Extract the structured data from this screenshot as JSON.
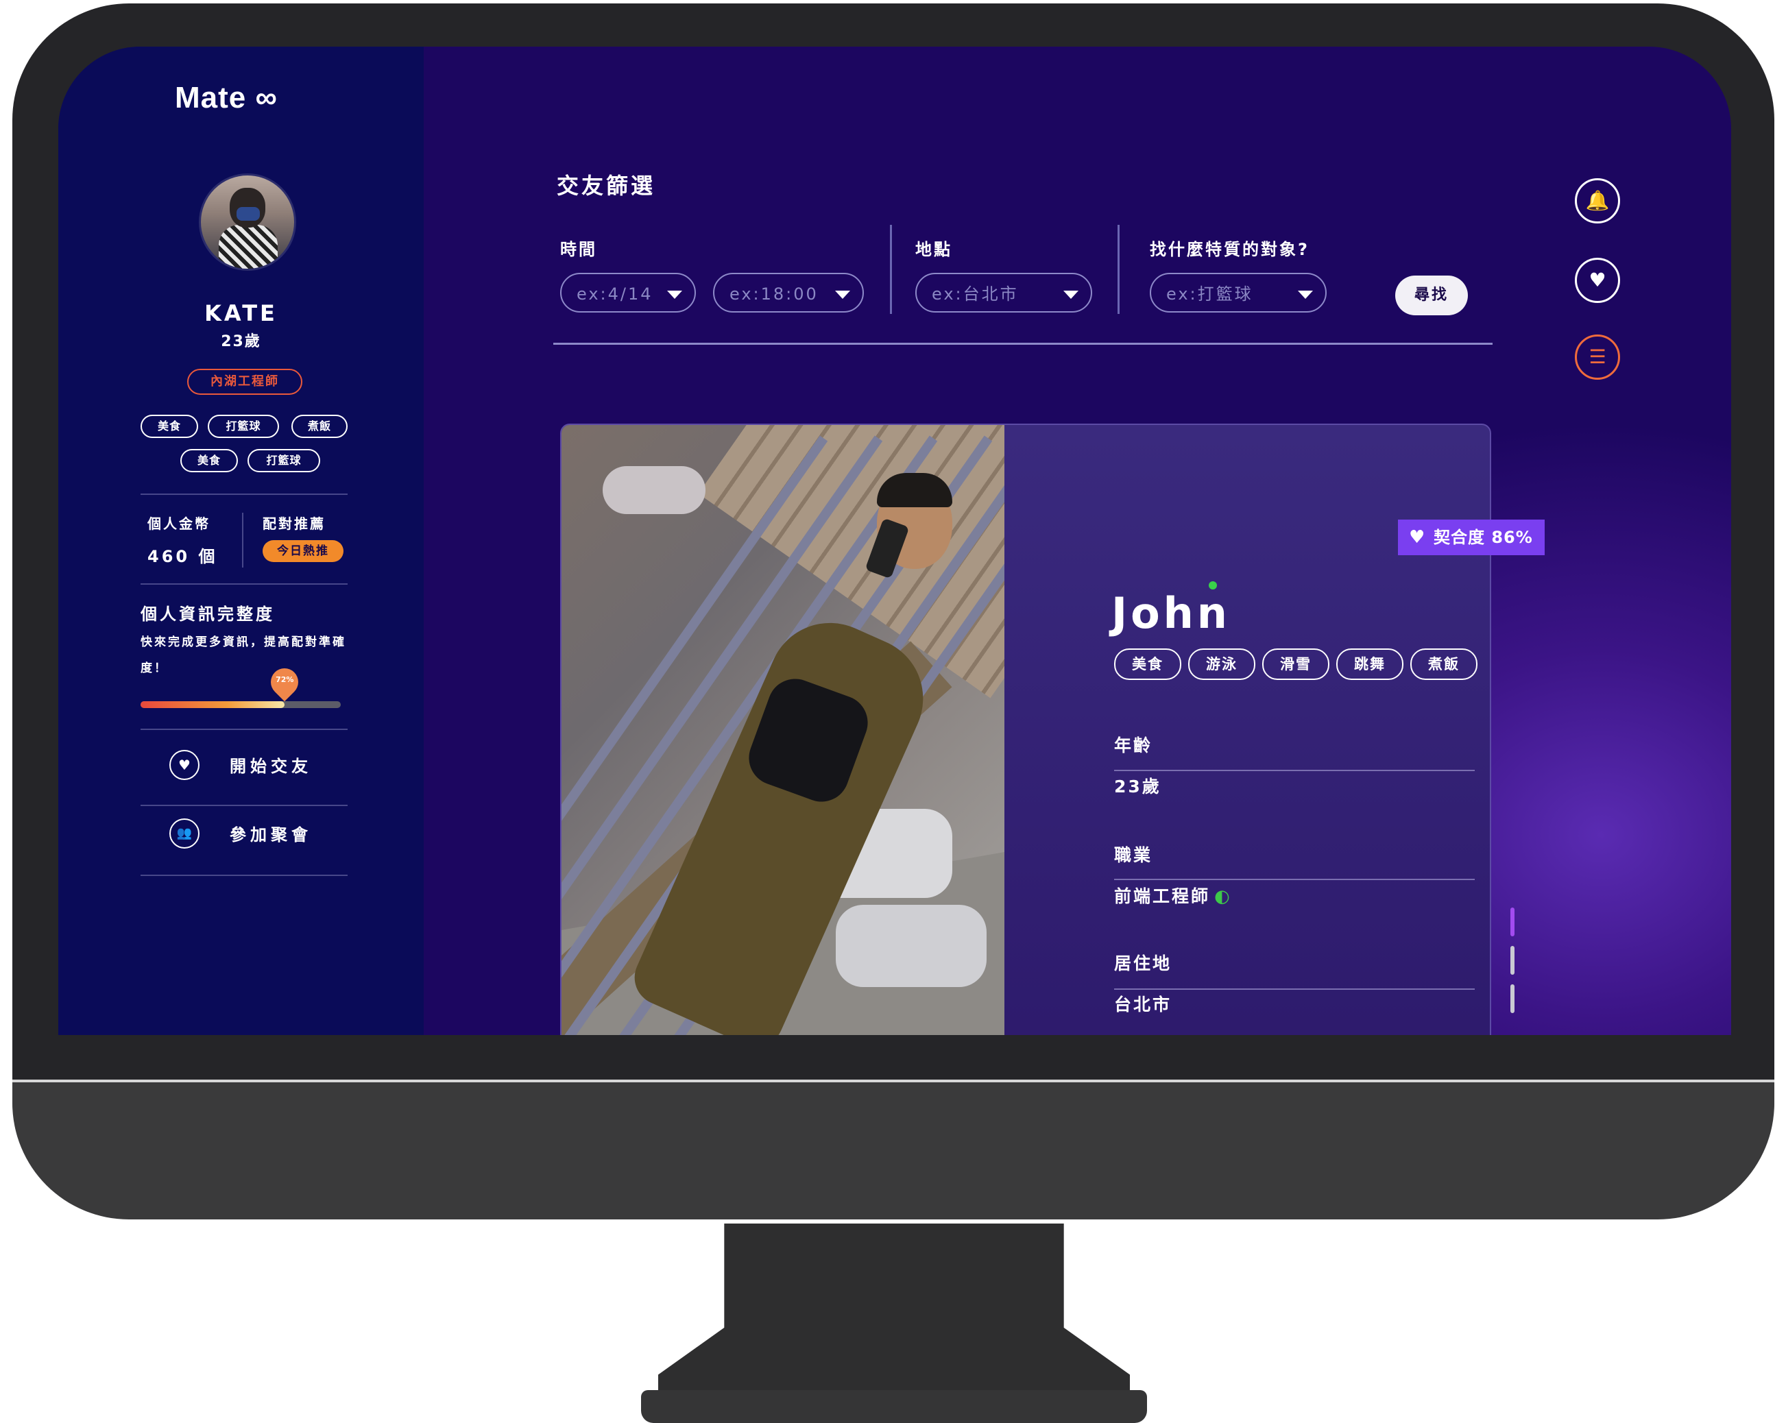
{
  "app": {
    "logo": "Mate ∞"
  },
  "sidebar": {
    "user": {
      "name": "KATE",
      "age": "23歲",
      "job": "內湖工程師"
    },
    "tags": [
      "美食",
      "打籃球",
      "煮飯",
      "美食",
      "打籃球"
    ],
    "stats": {
      "coins_label": "個人金幣",
      "coins_value": "460 個",
      "match_label": "配對推薦",
      "match_badge": "今日熱推"
    },
    "profile": {
      "title": "個人資訊完整度",
      "desc": "快來完成更多資訊，提高配對準確度！",
      "percent_label": "72%",
      "percent": 72
    },
    "menu": [
      {
        "icon": "heart-icon",
        "label": "開始交友"
      },
      {
        "icon": "people-icon",
        "label": "參加聚會"
      }
    ]
  },
  "filter": {
    "title": "交友篩選",
    "time_label": "時間",
    "date_placeholder": "ex:4/14",
    "time_placeholder": "ex:18:00",
    "place_label": "地點",
    "place_placeholder": "ex:台北市",
    "trait_label": "找什麼特質的對象?",
    "trait_placeholder": "ex:打籃球",
    "search_label": "尋找"
  },
  "side_icons": [
    "bell-icon",
    "heart-icon",
    "sliders-icon"
  ],
  "card": {
    "match_label": "契合度 86%",
    "name": "John",
    "tags": [
      "美食",
      "游泳",
      "滑雪",
      "跳舞",
      "煮飯"
    ],
    "age_label": "年齡",
    "age_value": "23歲",
    "job_label": "職業",
    "job_value": "前端工程師",
    "city_label": "居住地",
    "city_value": "台北市"
  },
  "colors": {
    "screen_bg": "#1c0660",
    "sidebar_bg": "#0a0b58",
    "accent_orange": "#e9593b",
    "match_purple": "#7a3ff0",
    "online_green": "#39d24a"
  }
}
